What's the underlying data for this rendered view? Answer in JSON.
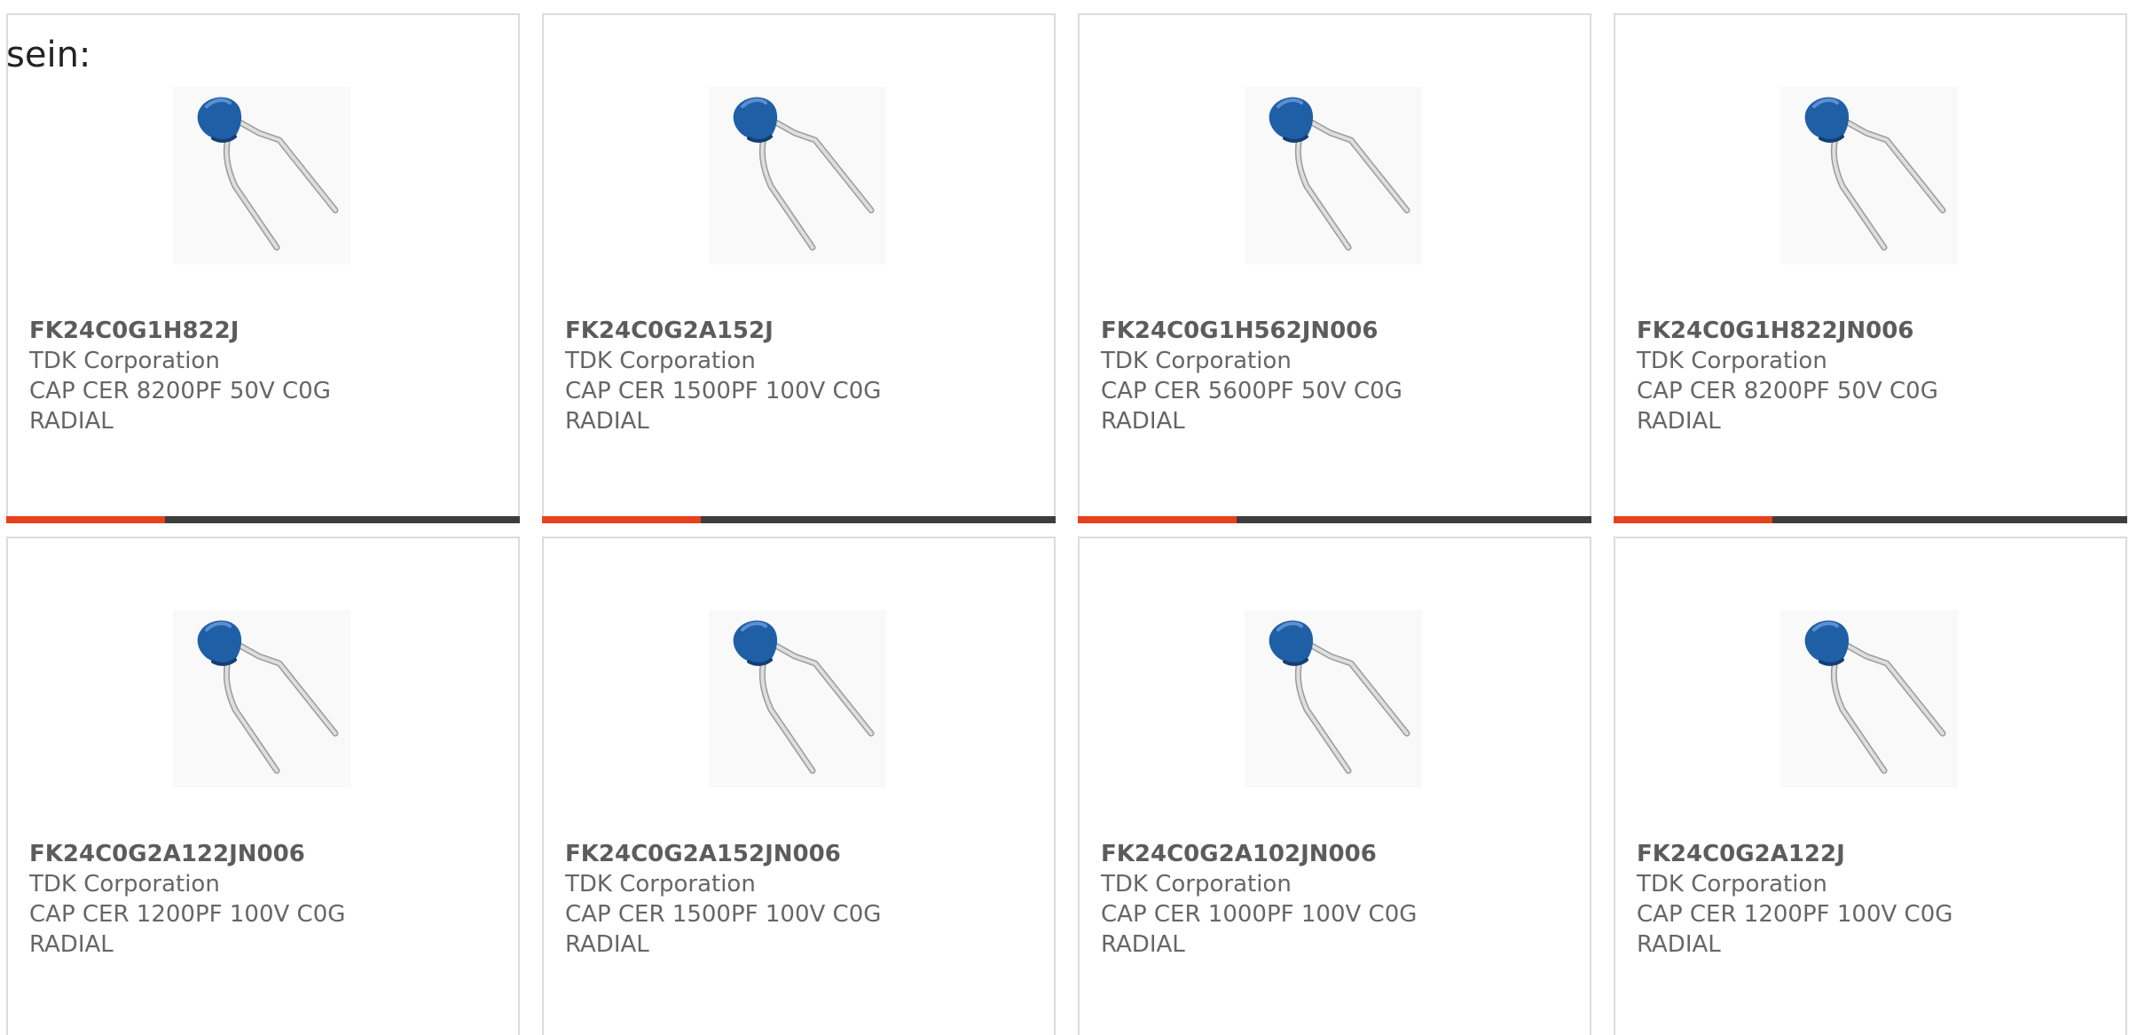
{
  "intro_text": "sein:",
  "colors": {
    "accent": "#e8401c",
    "track": "#3d3d3d",
    "capacitor_body": "#1f5fa6"
  },
  "products": [
    {
      "part_number": "FK24C0G1H822J",
      "manufacturer": "TDK Corporation",
      "description_line1": "CAP CER 8200PF 50V C0G",
      "description_line2": "RADIAL",
      "image_icon": "ceramic-capacitor-icon",
      "progress": 0.31
    },
    {
      "part_number": "FK24C0G2A152J",
      "manufacturer": "TDK Corporation",
      "description_line1": "CAP CER 1500PF 100V C0G",
      "description_line2": "RADIAL",
      "image_icon": "ceramic-capacitor-icon",
      "progress": 0.31
    },
    {
      "part_number": "FK24C0G1H562JN006",
      "manufacturer": "TDK Corporation",
      "description_line1": "CAP CER 5600PF 50V C0G",
      "description_line2": "RADIAL",
      "image_icon": "ceramic-capacitor-icon",
      "progress": 0.31
    },
    {
      "part_number": "FK24C0G1H822JN006",
      "manufacturer": "TDK Corporation",
      "description_line1": "CAP CER 8200PF 50V C0G",
      "description_line2": "RADIAL",
      "image_icon": "ceramic-capacitor-icon",
      "progress": 0.31
    },
    {
      "part_number": "FK24C0G2A122JN006",
      "manufacturer": "TDK Corporation",
      "description_line1": "CAP CER 1200PF 100V C0G",
      "description_line2": "RADIAL",
      "image_icon": "ceramic-capacitor-icon"
    },
    {
      "part_number": "FK24C0G2A152JN006",
      "manufacturer": "TDK Corporation",
      "description_line1": "CAP CER 1500PF 100V C0G",
      "description_line2": "RADIAL",
      "image_icon": "ceramic-capacitor-icon"
    },
    {
      "part_number": "FK24C0G2A102JN006",
      "manufacturer": "TDK Corporation",
      "description_line1": "CAP CER 1000PF 100V C0G",
      "description_line2": "RADIAL",
      "image_icon": "ceramic-capacitor-icon"
    },
    {
      "part_number": "FK24C0G2A122J",
      "manufacturer": "TDK Corporation",
      "description_line1": "CAP CER 1200PF 100V C0G",
      "description_line2": "RADIAL",
      "image_icon": "ceramic-capacitor-icon"
    }
  ]
}
